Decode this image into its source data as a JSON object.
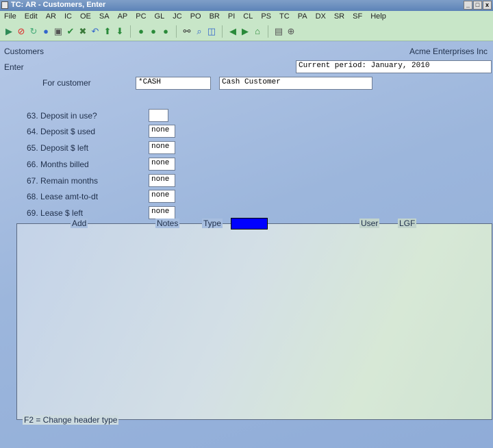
{
  "window": {
    "title": "TC: AR - Customers, Enter"
  },
  "menu": [
    "File",
    "Edit",
    "AR",
    "IC",
    "OE",
    "SA",
    "AP",
    "PC",
    "GL",
    "JC",
    "PO",
    "BR",
    "PI",
    "CL",
    "PS",
    "TC",
    "PA",
    "DX",
    "SR",
    "SF",
    "Help"
  ],
  "header": {
    "module": "Customers",
    "company": "Acme Enterprises Inc",
    "mode": "Enter",
    "period": "Current period: January, 2010"
  },
  "customer": {
    "label": "For customer",
    "code": "*CASH",
    "name": "Cash Customer"
  },
  "fields": [
    {
      "label": "63. Deposit in use?",
      "value": ""
    },
    {
      "label": "64. Deposit $ used",
      "value": "none"
    },
    {
      "label": "65. Deposit $ left",
      "value": "none"
    },
    {
      "label": "66. Months billed",
      "value": "none"
    },
    {
      "label": "67. Remain months",
      "value": "none"
    },
    {
      "label": "68. Lease amt-to-dt",
      "value": "none"
    },
    {
      "label": "69. Lease $ left",
      "value": "none"
    }
  ],
  "panel": {
    "add": "Add",
    "notes": "Notes",
    "type": "Type",
    "user": "User",
    "lgf": "LGF",
    "footer": "F2 = Change header type"
  },
  "colors": {
    "accent": "#0000ff",
    "menubar": "#c8e6c8",
    "background": "#9eb5d9"
  }
}
